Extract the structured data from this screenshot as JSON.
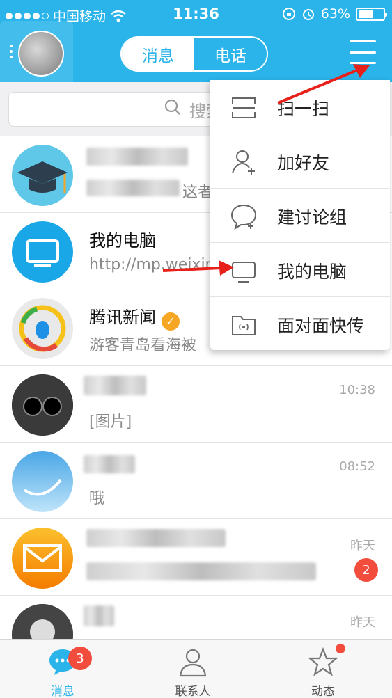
{
  "status_bar": {
    "carrier": "中国移动",
    "time": "11:36",
    "battery": "63%",
    "battery_level": 0.63
  },
  "header": {
    "segments": [
      {
        "label": "消息",
        "active": true
      },
      {
        "label": "电话",
        "active": false
      }
    ]
  },
  "search": {
    "placeholder": "搜索"
  },
  "conversations": [
    {
      "name": "",
      "message": "这者",
      "time": "",
      "avatar": "graduation-cap-avatar"
    },
    {
      "name": "我的电脑",
      "message": "http://mp.weixin",
      "time": "",
      "avatar": "monitor-avatar"
    },
    {
      "name": "腾讯新闻",
      "message": "游客青岛看海被",
      "time": "",
      "avatar": "tencent-news-avatar",
      "verified": true
    },
    {
      "name": "",
      "message": "[图片]",
      "time": "10:38",
      "avatar": "cat-avatar"
    },
    {
      "name": "",
      "message": "哦",
      "time": "08:52",
      "avatar": "sky-avatar"
    },
    {
      "name": "",
      "message": "",
      "time": "昨天",
      "avatar": "mail-avatar",
      "badge": "2"
    },
    {
      "name": "",
      "message": "",
      "time": "昨天",
      "avatar": "photo-avatar"
    }
  ],
  "dropdown": {
    "items": [
      {
        "label": "扫一扫",
        "icon": "scan-icon"
      },
      {
        "label": "加好友",
        "icon": "add-friend-icon"
      },
      {
        "label": "建讨论组",
        "icon": "discussion-group-icon"
      },
      {
        "label": "我的电脑",
        "icon": "my-computer-icon"
      },
      {
        "label": "面对面快传",
        "icon": "face-to-face-transfer-icon"
      }
    ]
  },
  "tabbar": {
    "tabs": [
      {
        "label": "消息",
        "icon": "message-icon",
        "active": true,
        "badge": "3"
      },
      {
        "label": "联系人",
        "icon": "contacts-icon",
        "active": false
      },
      {
        "label": "动态",
        "icon": "star-icon",
        "active": false,
        "dot": true
      }
    ]
  },
  "colors": {
    "accent": "#2ab4ea",
    "badge": "#f24c3d",
    "arrow": "#e8201a"
  }
}
